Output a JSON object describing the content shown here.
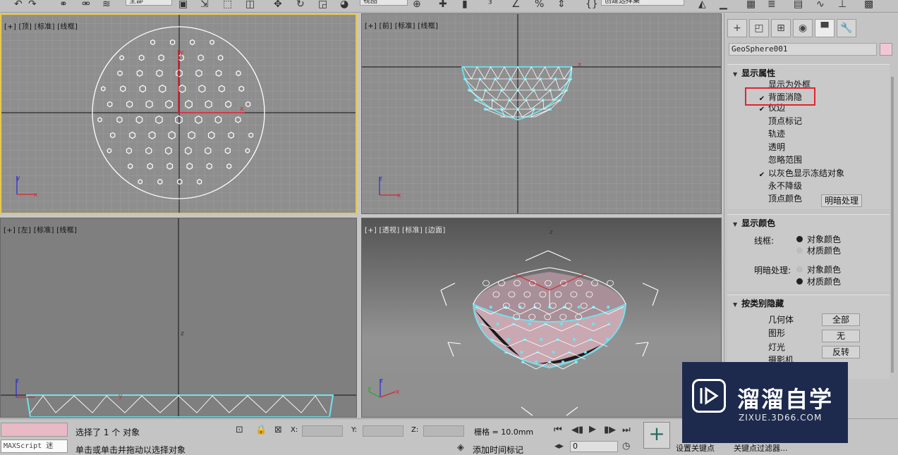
{
  "toolbar": {
    "selection_filter": "全部",
    "reference_coord": "视图",
    "named_selection": "创建选择集"
  },
  "viewports": {
    "top": {
      "label": "[+] [顶] [标准] [线框]"
    },
    "front": {
      "label": "[+] [前] [标准] [线框]"
    },
    "left": {
      "label": "[+] [左] [标准] [线框]"
    },
    "perspective": {
      "label": "[+] [透视] [标准] [边面]"
    }
  },
  "panel": {
    "object_name": "GeoSphere001",
    "object_color": "#f1c7d6",
    "display_properties": {
      "title": "显示属性",
      "items": [
        {
          "label": "显示为外框",
          "checked": false
        },
        {
          "label": "背面消隐",
          "checked": true
        },
        {
          "label": "仅边",
          "checked": true
        },
        {
          "label": "顶点标记",
          "checked": false
        },
        {
          "label": "轨迹",
          "checked": false
        },
        {
          "label": "透明",
          "checked": false
        },
        {
          "label": "忽略范围",
          "checked": false
        },
        {
          "label": "以灰色显示冻结对象",
          "checked": true
        },
        {
          "label": "永不降级",
          "checked": false
        },
        {
          "label": "顶点颜色",
          "checked": false
        }
      ],
      "shading_button": "明暗处理"
    },
    "display_color": {
      "title": "显示颜色",
      "wireframe_label": "线框:",
      "shaded_label": "明暗处理:",
      "object_color": "对象颜色",
      "material_color": "材质颜色"
    },
    "hide_by_category": {
      "title": "按类别隐藏",
      "items": [
        "几何体",
        "图形",
        "灯光",
        "摄影机"
      ],
      "buttons": [
        "全部",
        "无",
        "反转"
      ]
    }
  },
  "status": {
    "selected": "选择了 1 个 对象",
    "prompt": "单击或单击并拖动以选择对象",
    "maxscript": "MAXScript 迷",
    "x_label": "X:",
    "y_label": "Y:",
    "z_label": "Z:",
    "grid": "栅格 = 10.0mm",
    "add_time_tag": "添加时间标记",
    "frame": "0",
    "set_key": "设置关键点",
    "key_filters": "关键点过滤器..."
  },
  "watermark": {
    "name": "溜溜自学",
    "url": "ZIXUE.3D66.COM"
  },
  "accent_colors": {
    "active_viewport_border": "#e5c84c",
    "highlight_box": "#e0252e",
    "selection_wire": "#6fe3ee"
  }
}
